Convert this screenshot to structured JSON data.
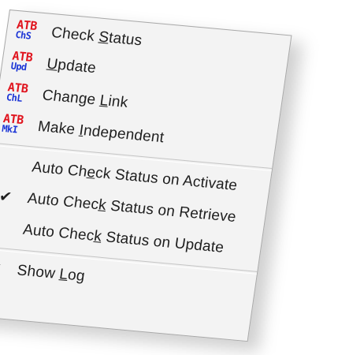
{
  "menu": {
    "items": [
      {
        "type": "command",
        "icon": {
          "name": "atb-check-status-icon",
          "top": "ATB",
          "bottom": "ChS"
        },
        "label": "Check Status",
        "accel": "S"
      },
      {
        "type": "command",
        "icon": {
          "name": "atb-update-icon",
          "top": "ATB",
          "bottom": "Upd"
        },
        "label": "Update",
        "accel": "U"
      },
      {
        "type": "command",
        "icon": {
          "name": "atb-change-link-icon",
          "top": "ATB",
          "bottom": "ChL"
        },
        "label": "Change Link",
        "accel": "L"
      },
      {
        "type": "command",
        "icon": {
          "name": "atb-make-independent-icon",
          "top": "ATB",
          "bottom": "MkI"
        },
        "label": "Make Independent",
        "accel": "I"
      },
      {
        "type": "separator"
      },
      {
        "type": "toggle",
        "checked": false,
        "label": "Auto Check Status on Activate",
        "accel": "e"
      },
      {
        "type": "toggle",
        "checked": true,
        "label": "Auto Check Status on Retrieve",
        "accel": "k"
      },
      {
        "type": "toggle",
        "checked": false,
        "label": "Auto Check Status on Update",
        "accel": "k"
      },
      {
        "type": "separator"
      },
      {
        "type": "toggle",
        "checked": true,
        "label": "Show Log",
        "accel": "L"
      }
    ]
  },
  "colors": {
    "menu_background": "#f3f3f3",
    "icon_top_red": "#e0141e",
    "icon_bottom_blue": "#1d36d6",
    "text": "#1e1e1e"
  },
  "check_glyph": "✔"
}
